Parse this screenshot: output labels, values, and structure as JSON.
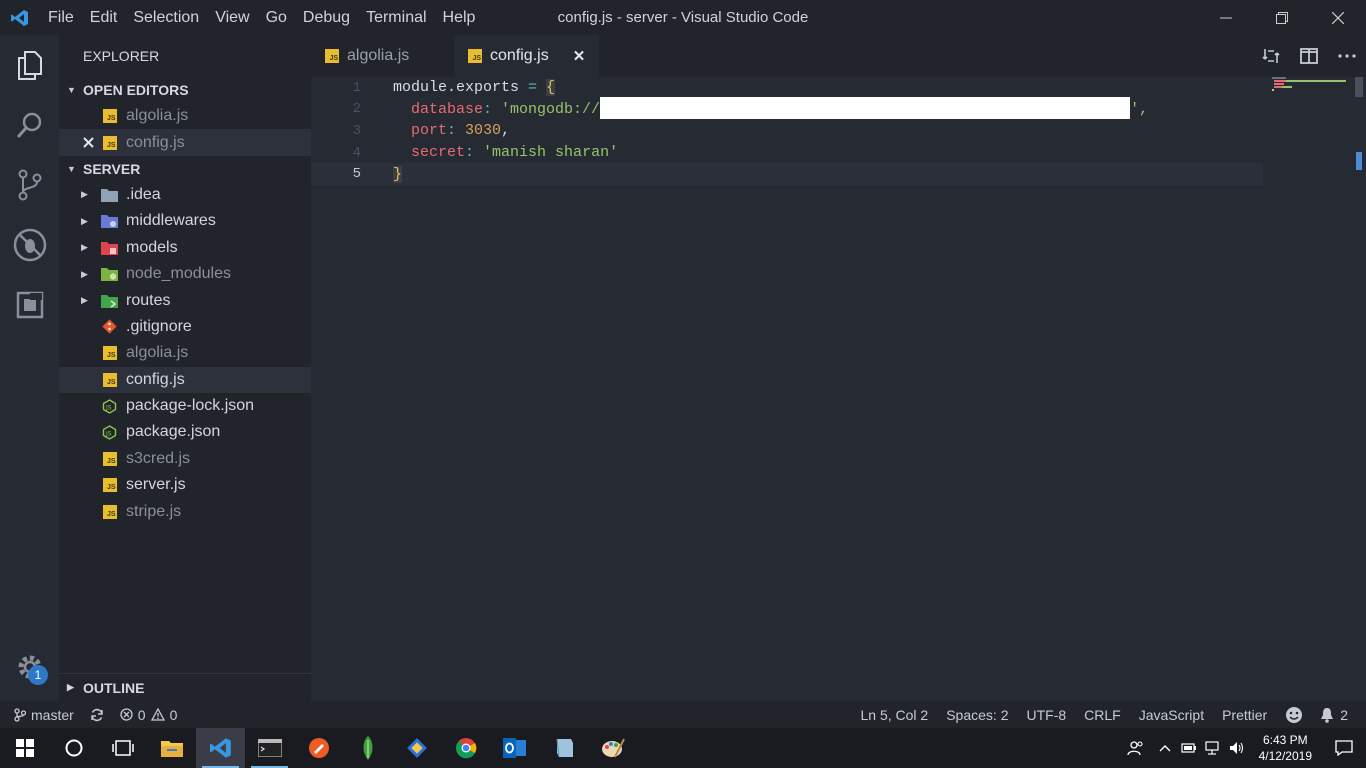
{
  "titlebar": {
    "menu": [
      "File",
      "Edit",
      "Selection",
      "View",
      "Go",
      "Debug",
      "Terminal",
      "Help"
    ],
    "window_title": "config.js - server - Visual Studio Code"
  },
  "activity_bar": {
    "items": [
      "files-icon",
      "search-icon",
      "source-control-icon",
      "debug-icon",
      "extensions-icon"
    ],
    "settings_badge": "1"
  },
  "sidebar": {
    "title": "EXPLORER",
    "open_editors_label": "OPEN EDITORS",
    "open_editors": [
      "algolia.js",
      "config.js"
    ],
    "folder_label": "SERVER",
    "tree": [
      {
        "name": ".idea",
        "type": "folder"
      },
      {
        "name": "middlewares",
        "type": "folder"
      },
      {
        "name": "models",
        "type": "folder"
      },
      {
        "name": "node_modules",
        "type": "folder"
      },
      {
        "name": "routes",
        "type": "folder"
      },
      {
        "name": ".gitignore",
        "type": "git"
      },
      {
        "name": "algolia.js",
        "type": "js"
      },
      {
        "name": "config.js",
        "type": "js"
      },
      {
        "name": "package-lock.json",
        "type": "json"
      },
      {
        "name": "package.json",
        "type": "json"
      },
      {
        "name": "s3cred.js",
        "type": "js"
      },
      {
        "name": "server.js",
        "type": "js"
      },
      {
        "name": "stripe.js",
        "type": "js"
      }
    ],
    "outline_label": "OUTLINE"
  },
  "tabs": [
    {
      "label": "algolia.js",
      "active": false
    },
    {
      "label": "config.js",
      "active": true
    }
  ],
  "editor": {
    "line_numbers": [
      "1",
      "2",
      "3",
      "4",
      "5"
    ],
    "tokens": {
      "module": "module",
      "exports": ".exports",
      "eq": " = ",
      "open": "{",
      "database_key": "database",
      "database_val_start": "'mongodb://",
      "database_val_end": "',",
      "port_key": "port",
      "port_val": "3030",
      "secret_key": "secret",
      "secret_val": "'manish sharan'",
      "close": "}"
    }
  },
  "status_bar": {
    "branch": "master",
    "errors": "0",
    "warnings": "0",
    "position": "Ln 5, Col 2",
    "spaces": "Spaces: 2",
    "encoding": "UTF-8",
    "eol": "CRLF",
    "language": "JavaScript",
    "formatter": "Prettier",
    "notifications": "2"
  },
  "taskbar": {
    "time": "6:43 PM",
    "date": "4/12/2019"
  },
  "colors": {
    "accent": "#2e78c7",
    "js_icon": "#e8bd30",
    "string": "#96c46c",
    "property": "#e86b73"
  }
}
